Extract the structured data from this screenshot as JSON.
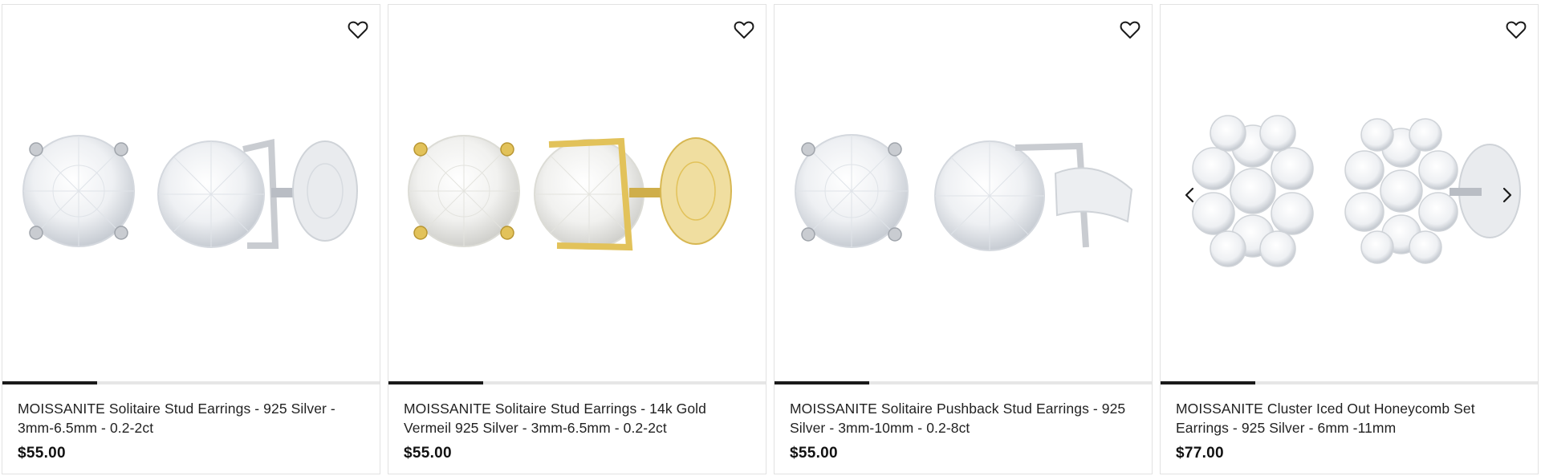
{
  "products": [
    {
      "title": "MOISSANITE Solitaire Stud Earrings - 925 Silver - 3mm-6.5mm - 0.2-2ct",
      "price": "$55.00",
      "image_progress": 0.25,
      "metal_color": "#c9ccd1",
      "icons": {
        "wishlist": "heart-outline-icon"
      }
    },
    {
      "title": "MOISSANITE Solitaire Stud Earrings - 14k Gold Vermeil 925 Silver - 3mm-6.5mm - 0.2-2ct",
      "price": "$55.00",
      "image_progress": 0.25,
      "metal_color": "#e2c25a",
      "icons": {
        "wishlist": "heart-outline-icon"
      }
    },
    {
      "title": "MOISSANITE Solitaire Pushback Stud Earrings - 925 Silver - 3mm-10mm - 0.2-8ct",
      "price": "$55.00",
      "image_progress": 0.25,
      "metal_color": "#c9ccd1",
      "icons": {
        "wishlist": "heart-outline-icon"
      }
    },
    {
      "title": "MOISSANITE Cluster Iced Out Honeycomb Set Earrings - 925 Silver - 6mm -11mm",
      "price": "$77.00",
      "image_progress": 0.25,
      "metal_color": "#c9ccd1",
      "icons": {
        "wishlist": "heart-outline-icon",
        "prev": "chevron-left-icon",
        "next": "chevron-right-icon"
      }
    }
  ]
}
